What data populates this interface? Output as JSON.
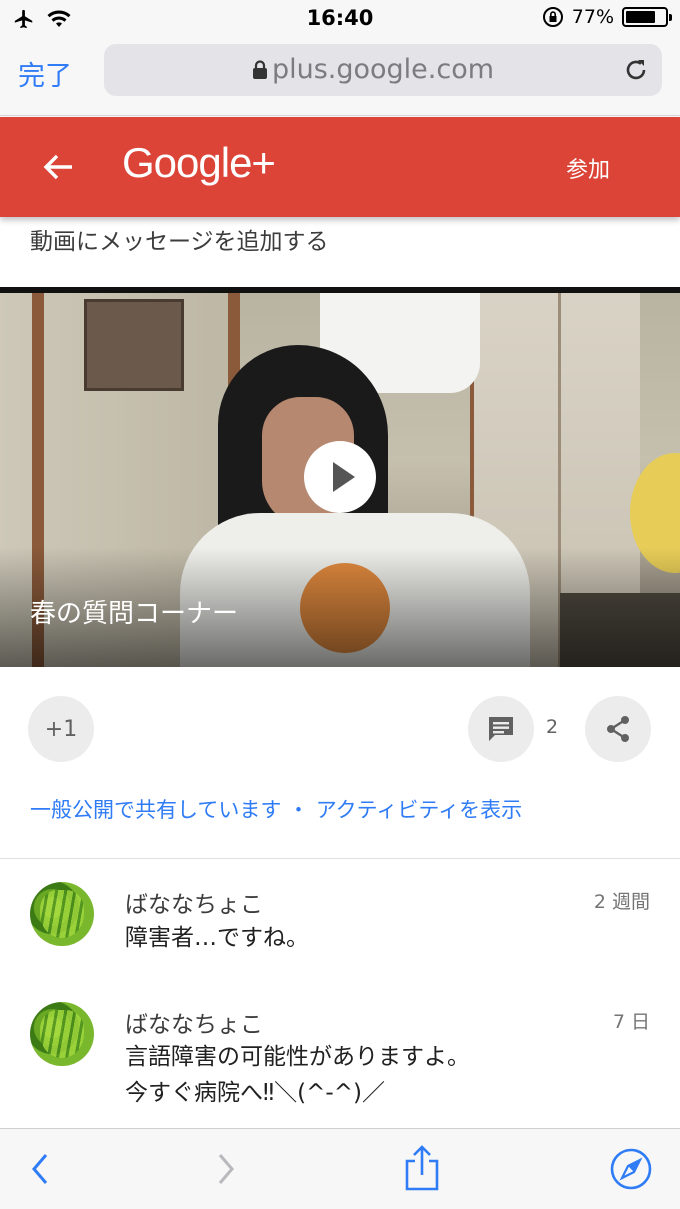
{
  "status_bar": {
    "time": "16:40",
    "battery": "77%",
    "battery_level": 0.77
  },
  "browser": {
    "done_label": "完了",
    "url": "plus.google.com"
  },
  "header": {
    "logo": "Google+",
    "join_label": "参加"
  },
  "post": {
    "message_prompt": "動画にメッセージを追加する",
    "video_title": "春の質問コーナー",
    "plus_one_label": "+1",
    "comment_count": "2",
    "visibility_text": "一般公開で共有しています ・ アクティビティを表示"
  },
  "comments": [
    {
      "author": "ばななちょこ",
      "time": "2 週間",
      "text_lines": [
        "障害者…ですね。"
      ]
    },
    {
      "author": "ばななちょこ",
      "time": "7 日",
      "text_lines": [
        "言語障害の可能性がありますよ。",
        "今すぐ病院へ‼＼(^-^)／"
      ]
    }
  ],
  "colors": {
    "gplus_red": "#db4437",
    "link_blue": "#2f7cf6",
    "safari_blue": "#2f7cf6"
  },
  "icons": {
    "status_left": [
      "airplane-icon",
      "wifi-icon"
    ],
    "status_right": [
      "orientation-lock-icon",
      "battery-icon"
    ],
    "toolbar": [
      "back-icon",
      "forward-icon",
      "share-icon",
      "compass-icon"
    ]
  }
}
